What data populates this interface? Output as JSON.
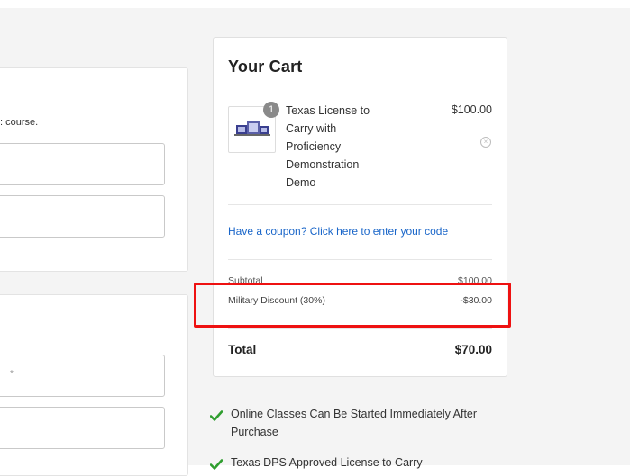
{
  "left_panel": {
    "description_fragment": ": course.",
    "required_marker": "*"
  },
  "cart": {
    "title": "Your Cart",
    "item": {
      "quantity": "1",
      "name": "Texas License to Carry with Proficiency Demonstration Demo",
      "price": "$100.00"
    },
    "coupon_link": "Have a coupon? Click here to enter your code",
    "subtotal_label": "Subtotal",
    "subtotal_value": "$100.00",
    "discount_label": "Military Discount (30%)",
    "discount_value": "-$30.00",
    "total_label": "Total",
    "total_value": "$70.00"
  },
  "features": [
    "Online Classes Can Be Started Immediately After Purchase",
    "Texas DPS Approved License to Carry"
  ],
  "colors": {
    "link": "#1a66c9",
    "highlight": "#ee1111",
    "check": "#2f9e2f"
  }
}
